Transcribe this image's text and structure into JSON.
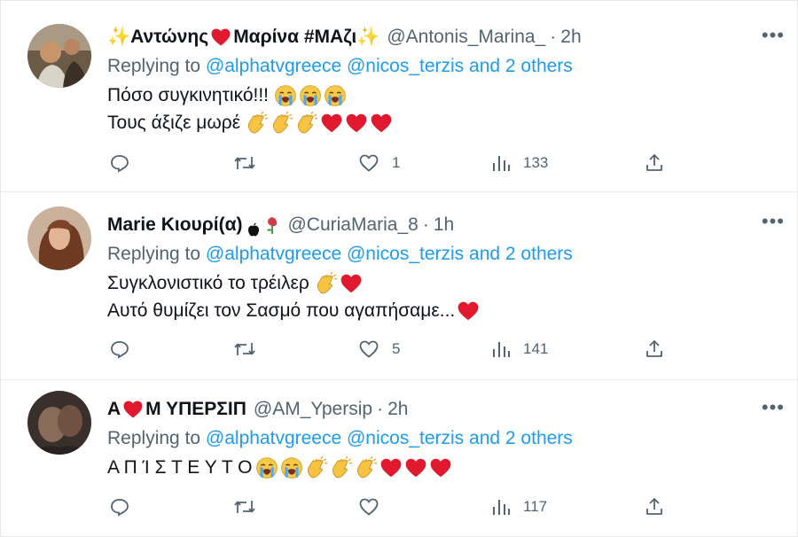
{
  "tweets": [
    {
      "name_prefix": "✨",
      "name_part1": "Αντώνης",
      "name_part2": "Μαρίνα #ΜΑζι",
      "name_suffix": "✨",
      "handle": "@Antonis_Marina_",
      "separator": "·",
      "time": "2h",
      "replying_label": "Replying to",
      "mentions": "@alphatvgreece @nicos_terzis",
      "and_others_label": "and",
      "others_count": "2 others",
      "body_line1": "Πόσο συγκινητικό!!!",
      "body_line2": "Τους άξιζε μωρέ",
      "likes": "1",
      "views": "133"
    },
    {
      "name": "Marie Κιουρί(α)",
      "handle": "@CuriaMaria_8",
      "separator": "·",
      "time": "1h",
      "replying_label": "Replying to",
      "mentions": "@alphatvgreece @nicos_terzis",
      "and_others_label": "and",
      "others_count": "2 others",
      "body_line1": "Συγκλονιστικό το τρέιλερ",
      "body_line2": "Αυτό θυμίζει τον Σασμό που αγαπήσαμε...",
      "likes": "5",
      "views": "141"
    },
    {
      "name_part1": "Α",
      "name_part2": "Μ ΥΠΕΡΣΙΠ",
      "handle": "@AM_Ypersip",
      "separator": "·",
      "time": "2h",
      "replying_label": "Replying to",
      "mentions": "@alphatvgreece @nicos_terzis",
      "and_others_label": "and",
      "others_count": "2 others",
      "body_line1": "Α Π Ί Σ Τ Ε Υ Τ Ο",
      "likes": "",
      "views": "117"
    }
  ],
  "more_label": "•••",
  "icons": {
    "reply": "reply-icon",
    "retweet": "retweet-icon",
    "like": "heart-icon",
    "views": "views-icon",
    "share": "share-icon",
    "emoji_crying": "loudly-crying-face-icon",
    "emoji_clap": "clapping-hands-icon",
    "emoji_heart": "red-heart-icon"
  },
  "colors": {
    "link": "#1d9bf0",
    "secondary": "#536471",
    "text": "#0f1419",
    "heart": "#e0192f"
  }
}
